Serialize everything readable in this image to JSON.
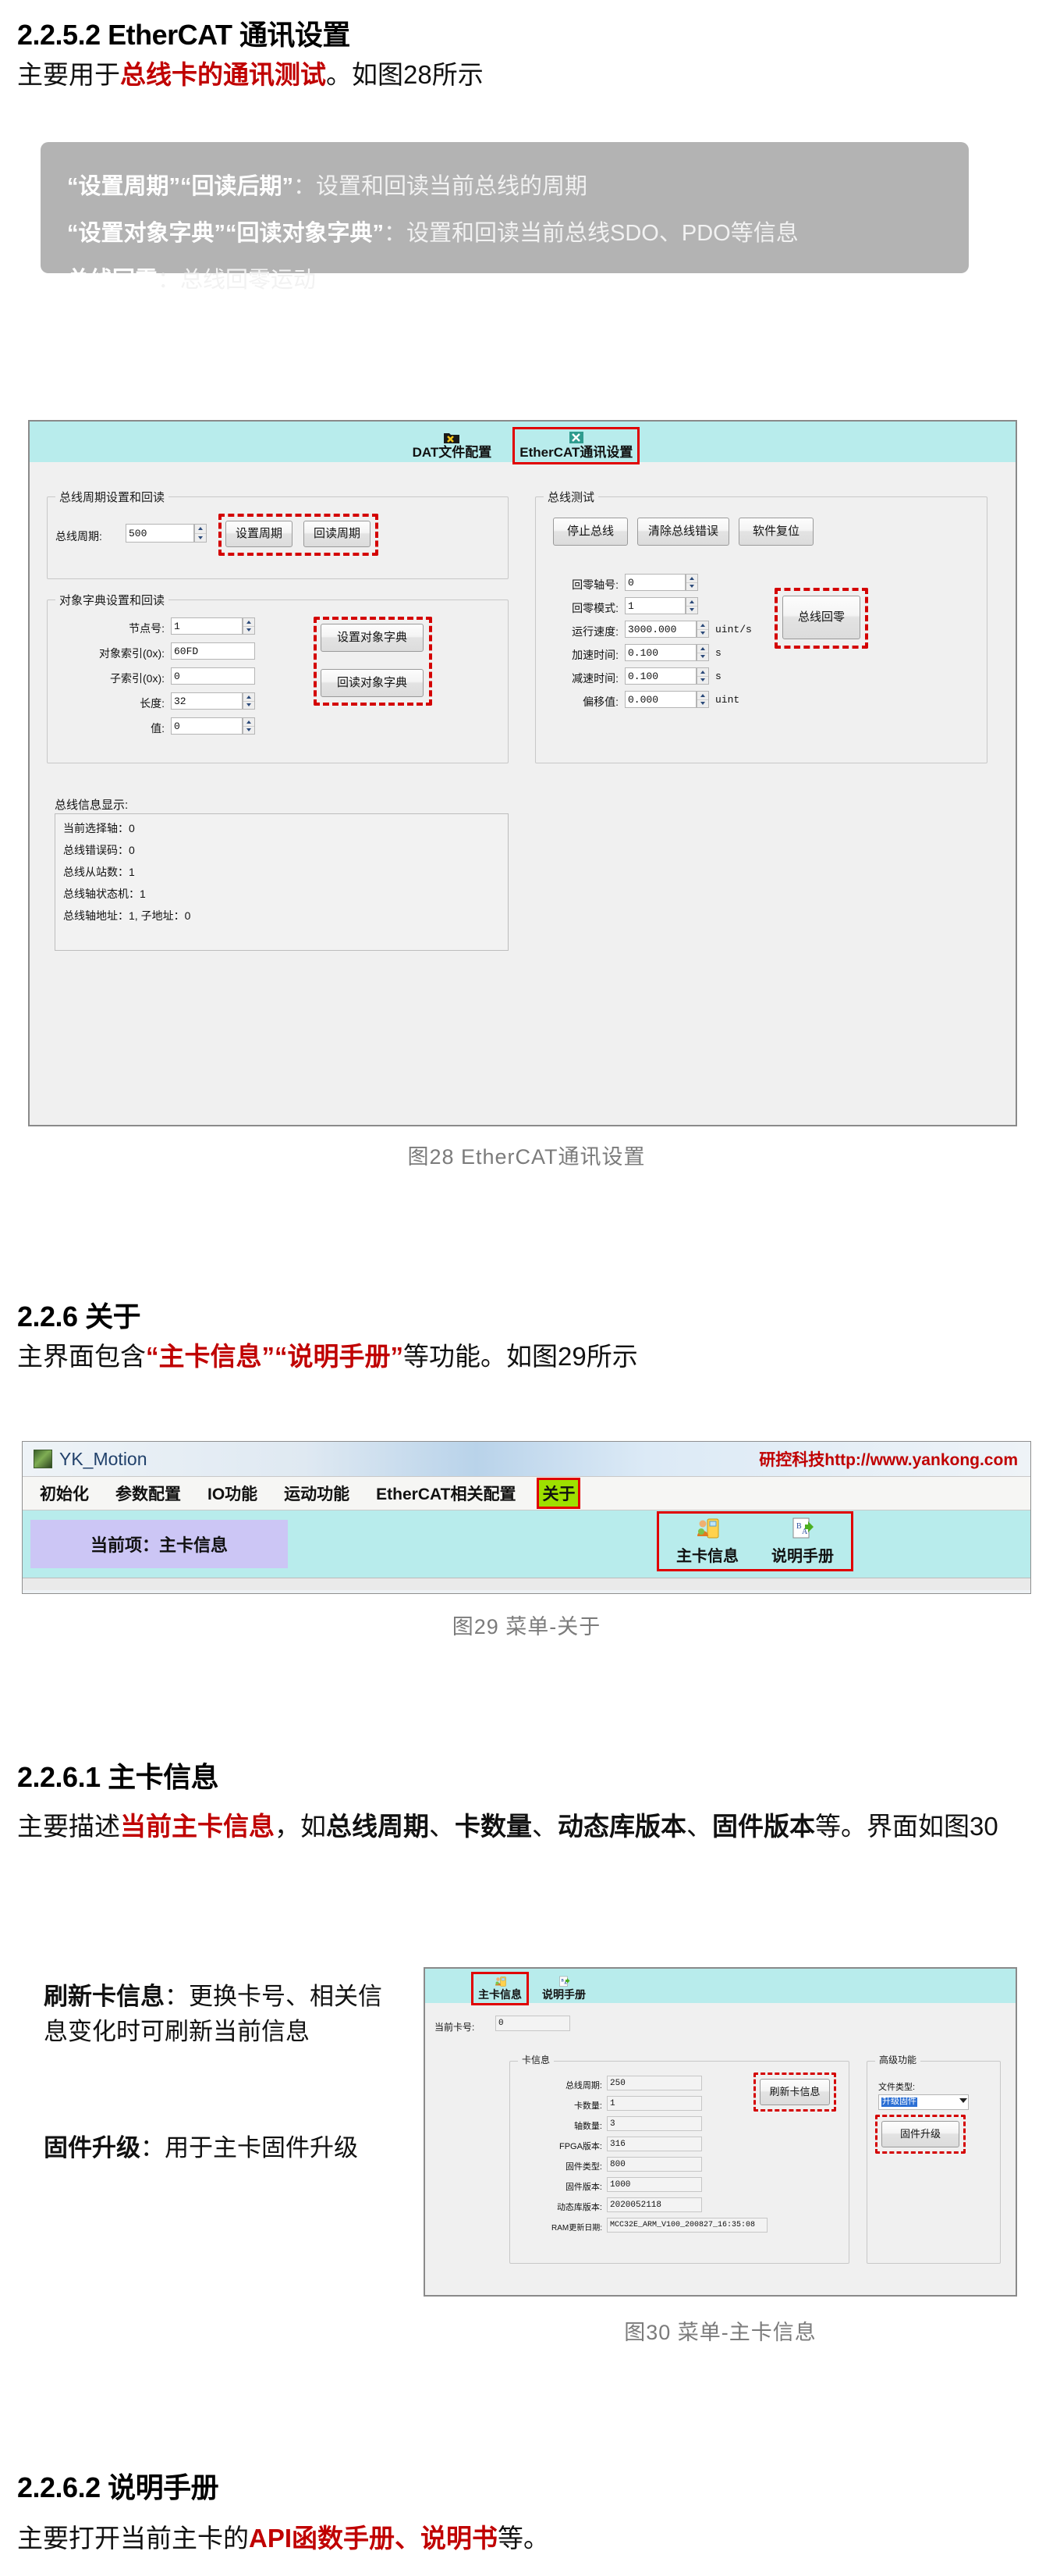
{
  "section_2252": {
    "heading": "2.2.5.2 EtherCAT 通讯设置",
    "intro_prefix": "主要用于",
    "intro_highlight": "总线卡的通讯测试",
    "intro_suffix": "。如图28所示"
  },
  "callout": {
    "lines": [
      {
        "bold": "“设置周期”“回读后期”",
        "rest": "：设置和回读当前总线的周期"
      },
      {
        "bold": "“设置对象字典”“回读对象字典”",
        "rest": "：设置和回读当前总线SDO、PDO等信息"
      },
      {
        "bold": "总线回零",
        "rest": "：总线回零运动"
      }
    ]
  },
  "fig28": {
    "caption": "图28 EtherCAT通讯设置",
    "tabs": [
      {
        "label": "DAT文件配置",
        "icon": "folder-tools-icon",
        "selected": false
      },
      {
        "label": "EtherCAT通讯设置",
        "icon": "tools-icon",
        "selected": true
      }
    ],
    "group_cycle": {
      "title": "总线周期设置和回读",
      "field_label": "总线周期:",
      "field_value": "500",
      "buttons": [
        "设置周期",
        "回读周期"
      ]
    },
    "group_objdict": {
      "title": "对象字典设置和回读",
      "fields": [
        {
          "label": "节点号:",
          "value": "1",
          "spinner": true
        },
        {
          "label": "对象索引(0x):",
          "value": "60FD",
          "spinner": false
        },
        {
          "label": "子索引(0x):",
          "value": "0",
          "spinner": false
        },
        {
          "label": "长度:",
          "value": "32",
          "spinner": true
        },
        {
          "label": "值:",
          "value": "0",
          "spinner": true
        }
      ],
      "buttons": [
        "设置对象字典",
        "回读对象字典"
      ]
    },
    "group_bustest": {
      "title": "总线测试",
      "top_buttons": [
        "停止总线",
        "清除总线错误",
        "软件复位"
      ],
      "fields": [
        {
          "label": "回零轴号:",
          "value": "0",
          "unit": ""
        },
        {
          "label": "回零模式:",
          "value": "1",
          "unit": ""
        },
        {
          "label": "运行速度:",
          "value": "3000.000",
          "unit": "uint/s"
        },
        {
          "label": "加速时间:",
          "value": "0.100",
          "unit": "s"
        },
        {
          "label": "减速时间:",
          "value": "0.100",
          "unit": "s"
        },
        {
          "label": "偏移值:",
          "value": "0.000",
          "unit": "uint"
        }
      ],
      "homing_button": "总线回零"
    },
    "info_panel": {
      "title": "总线信息显示:",
      "lines": [
        "当前选择轴：0",
        "总线错误码：0",
        "总线从站数：1",
        "总线轴状态机：1",
        "总线轴地址：1, 子地址：0"
      ]
    }
  },
  "section_226": {
    "heading": "2.2.6 关于",
    "intro_prefix": "主界面包含",
    "intro_highlight_1": "“主卡信息”",
    "intro_highlight_2": "“说明手册”",
    "intro_suffix": "等功能。如图29所示"
  },
  "fig29": {
    "caption": "图29 菜单-关于",
    "window_title": "YK_Motion",
    "window_url": "研控科技http://www.yankong.com",
    "menu_items": [
      "初始化",
      "参数配置",
      "IO功能",
      "运动功能",
      "EtherCAT相关配置",
      "关于"
    ],
    "menu_selected": "关于",
    "current_item": "当前项：主卡信息",
    "tools": [
      {
        "label": "主卡信息",
        "icon": "card-info-icon"
      },
      {
        "label": "说明手册",
        "icon": "manual-icon"
      }
    ]
  },
  "section_2261": {
    "heading": "2.2.6.1 主卡信息",
    "line1_prefix": "主要描述",
    "line1_highlight": "当前主卡信息",
    "line1_mid": "，如",
    "line1_b1": "总线周期",
    "line1_sep1": "、",
    "line1_b2": "卡数量",
    "line1_sep2": "、",
    "line1_b3": "动态库版本",
    "line2_sep": "、",
    "line2_b4": "固件版本",
    "line2_suffix": "等。界面如图30"
  },
  "notes_left": [
    {
      "bold": "刷新卡信息",
      "rest": "：更换卡号、相关信息变化时可刷新当前信息"
    },
    {
      "bold": "固件升级",
      "rest": "：用于主卡固件升级"
    }
  ],
  "fig30": {
    "caption": "图30  菜单-主卡信息",
    "tabs": [
      {
        "label": "主卡信息",
        "icon": "card-info-icon",
        "selected": true
      },
      {
        "label": "说明手册",
        "icon": "manual-icon",
        "selected": false
      }
    ],
    "current_card_label": "当前卡号:",
    "current_card_value": "0",
    "group_cardinfo": {
      "title": "卡信息",
      "fields": [
        {
          "label": "总线周期:",
          "value": "250"
        },
        {
          "label": "卡数量:",
          "value": "1"
        },
        {
          "label": "轴数量:",
          "value": "3"
        },
        {
          "label": "FPGA版本:",
          "value": "316"
        },
        {
          "label": "固件类型:",
          "value": "800"
        },
        {
          "label": "固件版本:",
          "value": "1000"
        },
        {
          "label": "动态库版本:",
          "value": "2020052118"
        },
        {
          "label": "RAM更新日期:",
          "value": "MCC32E_ARM_V100_200827_16:35:08"
        }
      ],
      "refresh_button": "刷新卡信息"
    },
    "group_advanced": {
      "title": "高级功能",
      "filetype_label": "文件类型:",
      "filetype_value": "升级固件",
      "upgrade_button": "固件升级"
    }
  },
  "section_2262": {
    "heading": "2.2.6.2 说明手册",
    "line_prefix": "主要打开当前主卡的",
    "line_highlight_1": "API函数手册",
    "line_sep": "、",
    "line_highlight_2": "说明书",
    "line_suffix": "等。"
  },
  "colors": {
    "accent_red": "#c00000",
    "annotation_red": "#d40000",
    "tab_cyan": "#b8ecec",
    "menu_highlight_green": "#9ee000",
    "callout_gray": "#b3b3b3",
    "caption_gray": "#7b7b7b",
    "current_item_purple": "#ccc6f5"
  }
}
